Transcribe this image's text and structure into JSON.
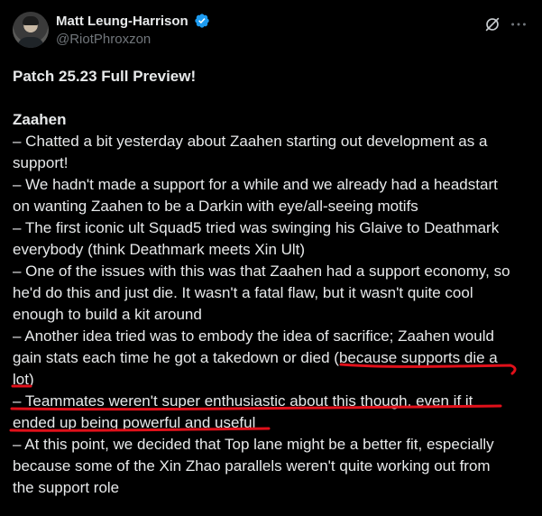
{
  "author": {
    "display_name": "Matt Leung-Harrison",
    "handle": "@RiotPhroxzon",
    "verified": true,
    "verified_color": "#1d9bf0",
    "avatar_icon": "avatar-photo"
  },
  "actions": {
    "grok_icon": "grok-icon",
    "more_icon": "more-horizontal-icon"
  },
  "post": {
    "title": "Patch 25.23 Full Preview!",
    "section_heading": "Zaahen",
    "lines": [
      "– Chatted a bit yesterday about Zaahen starting out development as a",
      "support!",
      "– We hadn't made a support for a while and we already had a headstart",
      "on wanting Zaahen to be a Darkin with eye/all-seeing motifs",
      "– The first iconic ult Squad5 tried was swinging his Glaive to Deathmark",
      "everybody (think Deathmark meets Xin Ult)",
      "– One of the issues with this was that Zaahen had a support economy, so",
      "he'd do this and just die. It wasn't a fatal flaw, but it wasn't quite cool",
      "enough to build a kit around",
      "– Another idea tried was to embody the idea of sacrifice; Zaahen would",
      "gain stats each time he got a takedown or died (because supports die a",
      "lot)",
      "– Teammates weren't super enthusiastic about this though, even if it",
      "ended up being powerful and useful",
      "– At this point, we decided that Top lane might be a better fit, especially",
      "because some of the Xin Zhao parallels weren't quite working out from",
      "the support role"
    ]
  },
  "theme": {
    "background": "#000000",
    "text": "#e7e9ea",
    "muted": "#71767b",
    "annotation_color": "#e0101a"
  }
}
